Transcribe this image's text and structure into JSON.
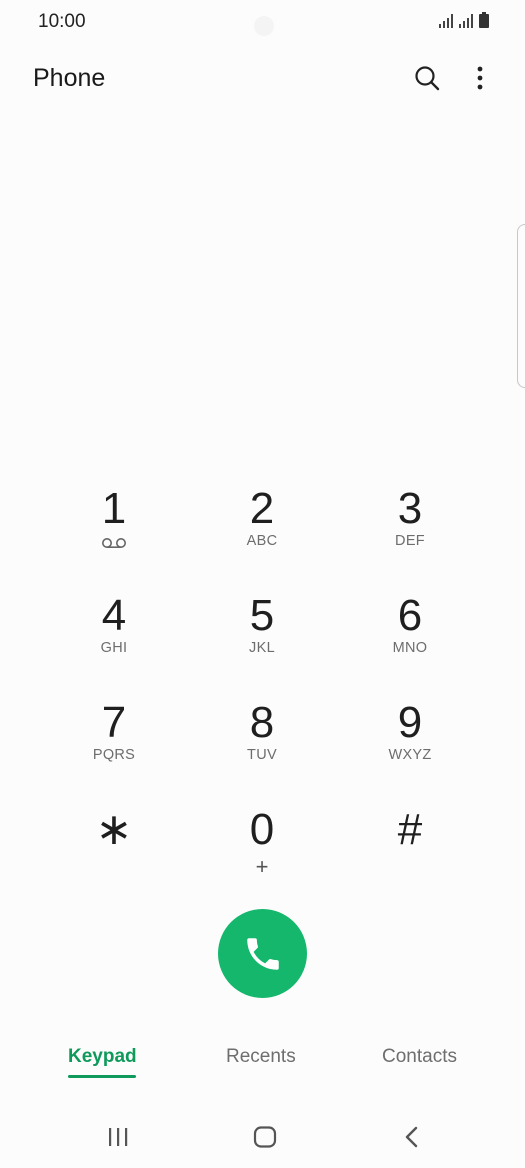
{
  "status_bar": {
    "time": "10:00",
    "icons": [
      "signal-icon",
      "signal-icon",
      "battery-icon"
    ]
  },
  "app_bar": {
    "title": "Phone",
    "actions": [
      "search-icon",
      "more-vert-icon"
    ]
  },
  "keypad": {
    "keys": [
      {
        "digit": "1",
        "letters": "",
        "sub_icon": "voicemail-icon"
      },
      {
        "digit": "2",
        "letters": "ABC"
      },
      {
        "digit": "3",
        "letters": "DEF"
      },
      {
        "digit": "4",
        "letters": "GHI"
      },
      {
        "digit": "5",
        "letters": "JKL"
      },
      {
        "digit": "6",
        "letters": "MNO"
      },
      {
        "digit": "7",
        "letters": "PQRS"
      },
      {
        "digit": "8",
        "letters": "TUV"
      },
      {
        "digit": "9",
        "letters": "WXYZ"
      },
      {
        "digit": "∗",
        "letters": ""
      },
      {
        "digit": "0",
        "letters": "+"
      },
      {
        "digit": "#",
        "letters": ""
      }
    ]
  },
  "call_button": {
    "icon": "phone-icon",
    "color": "#15b76c"
  },
  "tabs": [
    {
      "label": "Keypad",
      "active": true
    },
    {
      "label": "Recents",
      "active": false
    },
    {
      "label": "Contacts",
      "active": false
    }
  ],
  "accent_color": "#0f9a5c",
  "nav_bar": [
    "recent-apps-icon",
    "home-icon",
    "back-icon"
  ]
}
